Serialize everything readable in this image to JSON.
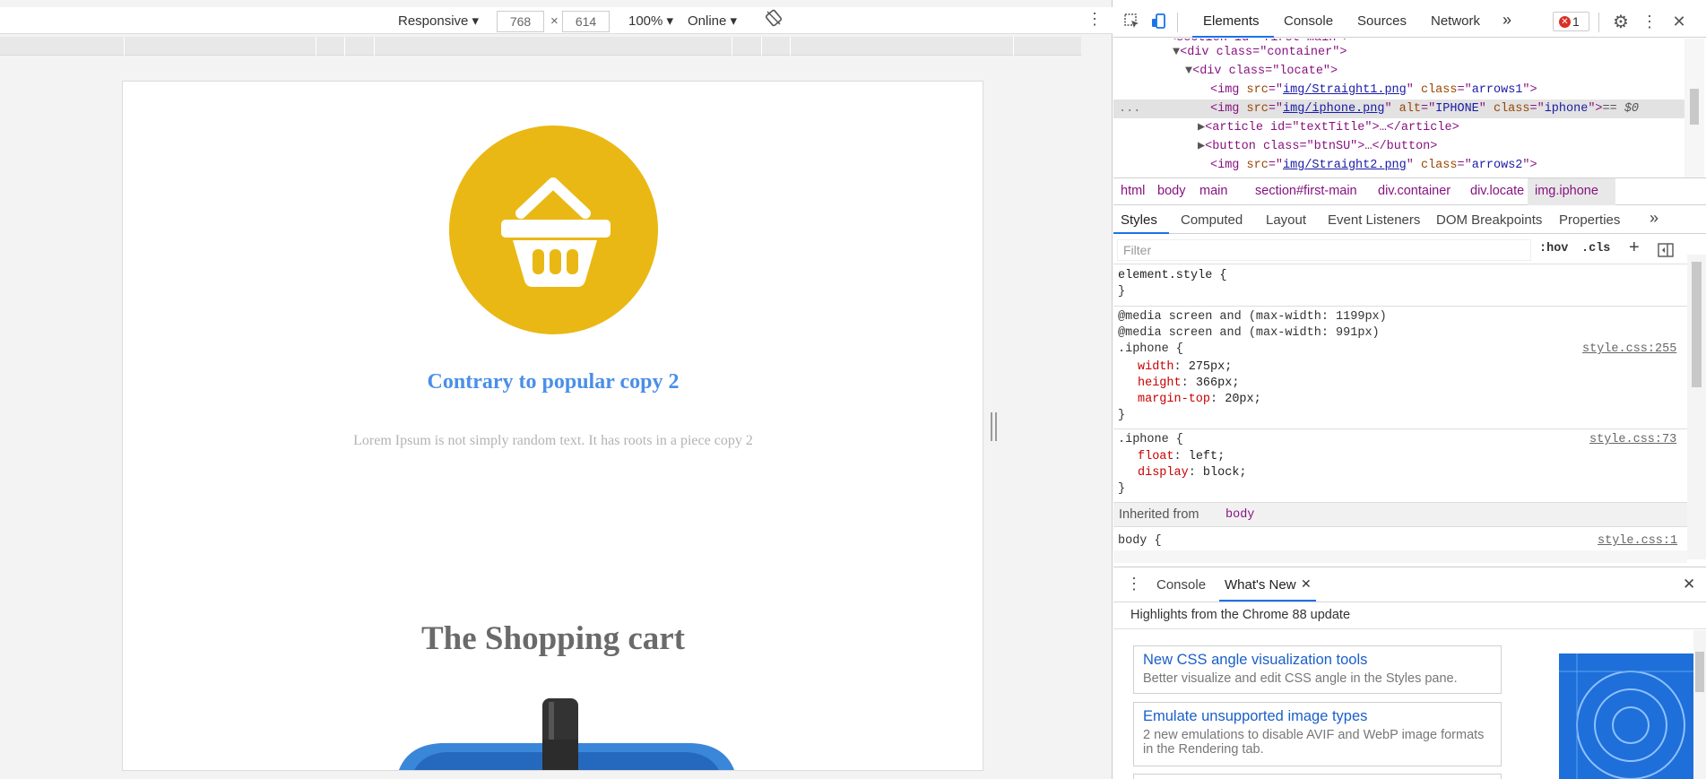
{
  "device_toolbar": {
    "mode": "Responsive",
    "width": "768",
    "times": "×",
    "height": "614",
    "zoom": "100%",
    "network": "Online"
  },
  "page": {
    "circle_color": "#eab814",
    "heading": "Contrary to popular copy 2",
    "body": "Lorem Ipsum is not simply random text. It has roots in a piece copy 2",
    "section_title": "The Shopping cart"
  },
  "devtools": {
    "tabs": [
      "Elements",
      "Console",
      "Sources",
      "Network"
    ],
    "more_tabs": "»",
    "error_count": "1",
    "dom": {
      "line0": "<section id=\"first-main\">",
      "container_open": "<div class=\"container\">",
      "locate_open": "<div class=\"locate\">",
      "arrows1_src": "img/Straight1.png",
      "arrows1_class": "arrows1",
      "iphone_src": "img/iphone.png",
      "iphone_alt": "IPHONE",
      "iphone_class": "iphone",
      "selected_suffix": "== $0",
      "article": "<article id=\"textTitle\">…</article>",
      "button": "<button class=\"btnSU\">…</button>",
      "arrows2_src": "img/Straight2.png",
      "arrows2_class": "arrows2",
      "ellipsis": "..."
    },
    "breadcrumbs": [
      "html",
      "body",
      "main",
      "section#first-main",
      "div.container",
      "div.locate",
      "img.iphone"
    ],
    "subtabs": [
      "Styles",
      "Computed",
      "Layout",
      "Event Listeners",
      "DOM Breakpoints",
      "Properties"
    ],
    "subtabs_more": "»",
    "filter_placeholder": "Filter",
    "hov": ":hov",
    "cls": ".cls",
    "plus": "+",
    "styles": {
      "element_style": "element.style {",
      "close_brace": "}",
      "media1": "@media screen and (max-width: 1199px)",
      "media2": "@media screen and (max-width: 991px)",
      "rule1_selector": ".iphone {",
      "rule1_source": "style.css:255",
      "rule1_props": [
        {
          "name": "width",
          "value": "275px;"
        },
        {
          "name": "height",
          "value": "366px;"
        },
        {
          "name": "margin-top",
          "value": "20px;"
        }
      ],
      "rule2_selector": ".iphone {",
      "rule2_source": "style.css:73",
      "rule2_props": [
        {
          "name": "float",
          "value": "left;"
        },
        {
          "name": "display",
          "value": "block;"
        }
      ],
      "inherited_label": "Inherited from",
      "inherited_from": "body",
      "body_selector": "body {",
      "body_source": "style.css:1"
    },
    "drawer": {
      "tabs": [
        "Console",
        "What's New"
      ],
      "close_x": "✕",
      "highlights": "Highlights from the Chrome 88 update",
      "cards": [
        {
          "title": "New CSS angle visualization tools",
          "desc": "Better visualize and edit CSS angle in the Styles pane."
        },
        {
          "title": "Emulate unsupported image types",
          "desc": "2 new emulations to disable AVIF and WebP image formats in the Rendering tab."
        }
      ]
    }
  }
}
